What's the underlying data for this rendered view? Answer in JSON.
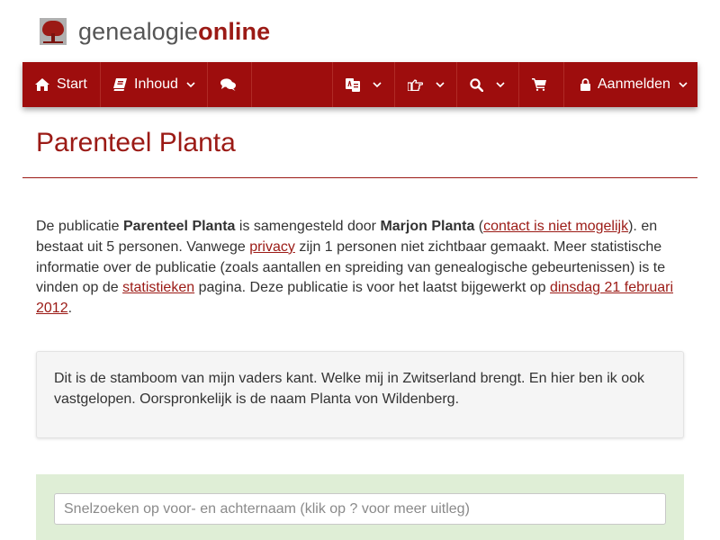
{
  "logo": {
    "text_plain": "genealogie",
    "text_accent": "online"
  },
  "nav": {
    "start_label": "Start",
    "inhoud_label": "Inhoud",
    "login_label": "Aanmelden",
    "icons": [
      "home-icon",
      "book-icon",
      "comments-icon",
      "language-icon",
      "hand-pointer-icon",
      "search-icon",
      "shopping-cart-icon",
      "lock-icon"
    ]
  },
  "page": {
    "title": "Parenteel Planta"
  },
  "intro": {
    "t1": "De publicatie ",
    "pub_name": "Parenteel Planta",
    "t2": " is samengesteld door ",
    "author": "Marjon Planta",
    "t3": " (",
    "contact_link": "contact is niet mogelijk",
    "t4": "). en bestaat uit 5 personen. Vanwege ",
    "privacy_link": "privacy",
    "t5": " zijn 1 personen niet zichtbaar gemaakt. Meer statistische informatie over de publicatie (zoals aantallen en spreiding van genealogische gebeurtenissen) is te vinden op de ",
    "stats_link": "statistieken",
    "t6": " pagina. Deze publicatie is voor het laatst bijgewerkt op ",
    "date_link": "dinsdag 21 februari 2012",
    "t7": "."
  },
  "description": "Dit is de stamboom van mijn vaders kant. Welke mij in Zwitserland brengt. En hier ben ik ook vastgelopen. Oorspronkelijk is de naam Planta von Wildenberg.",
  "search": {
    "placeholder": "Snelzoeken op voor- en achternaam (klik op ? voor meer uitleg)"
  },
  "colors": {
    "brand": "#9e0d0d",
    "accent_text": "#9b1a15",
    "search_panel_bg": "#dfeed6",
    "well_bg": "#f5f5f5"
  }
}
